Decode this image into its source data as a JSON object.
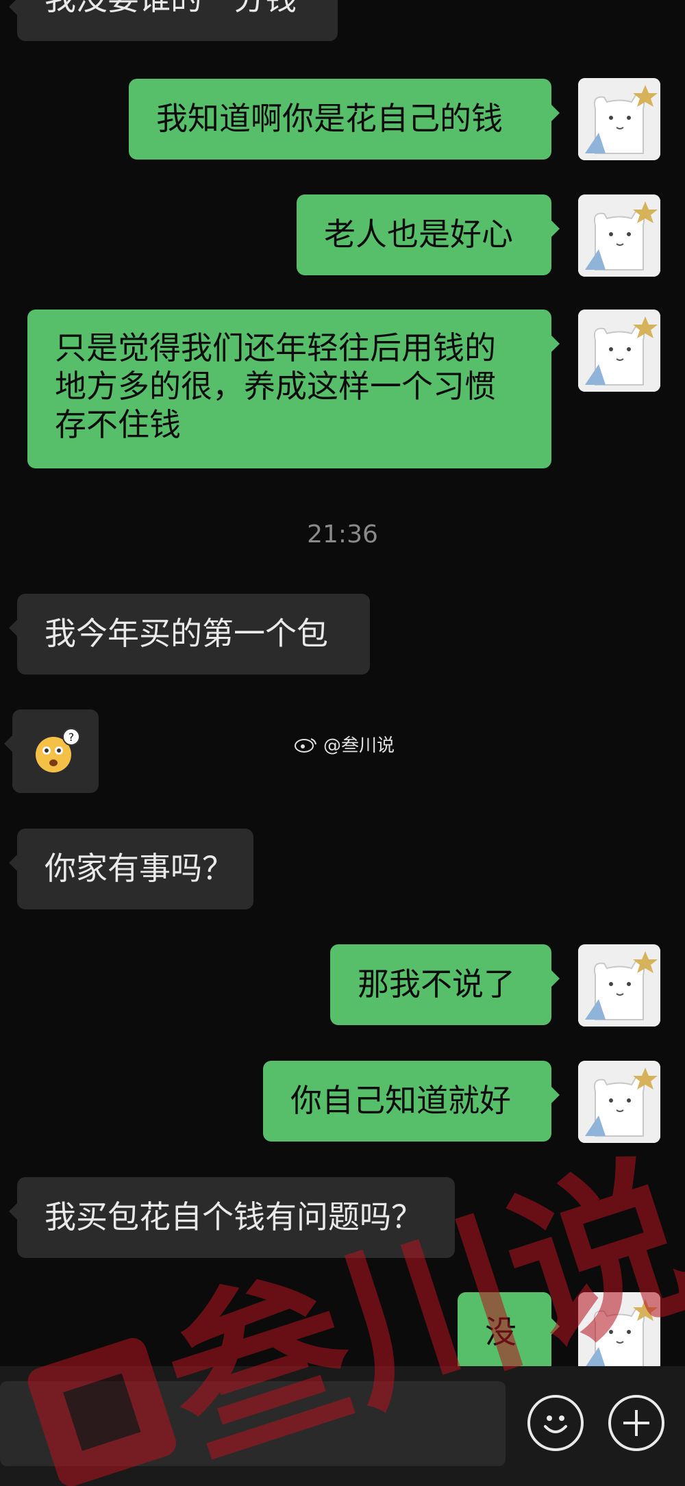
{
  "messages": [
    {
      "side": "left",
      "text": "我没要谁的一分钱"
    },
    {
      "side": "right",
      "text": "我知道啊你是花自己的钱"
    },
    {
      "side": "right",
      "text": "老人也是好心"
    },
    {
      "side": "right",
      "text": "只是觉得我们还年轻往后用钱的地方多的很，养成这样一个习惯存不住钱"
    },
    {
      "side": "left",
      "text": "我今年买的第一个包"
    },
    {
      "side": "left",
      "text": "你家有事吗？"
    },
    {
      "side": "right",
      "text": "那我不说了"
    },
    {
      "side": "right",
      "text": "你自己知道就好"
    },
    {
      "side": "left",
      "text": "我买包花自个钱有问题吗？"
    },
    {
      "side": "right",
      "text": "没"
    }
  ],
  "time_label": "21:36",
  "weibo_handle": "@叁川说",
  "watermark_text": "叁川说",
  "bottom_bar": {
    "emoji_icon": "smiley-icon",
    "plus_icon": "plus-icon"
  },
  "colors": {
    "background": "#0b0b0b",
    "incoming_bubble": "#2b2b2b",
    "outgoing_bubble": "#57bf6a",
    "watermark": "#b4141e"
  }
}
